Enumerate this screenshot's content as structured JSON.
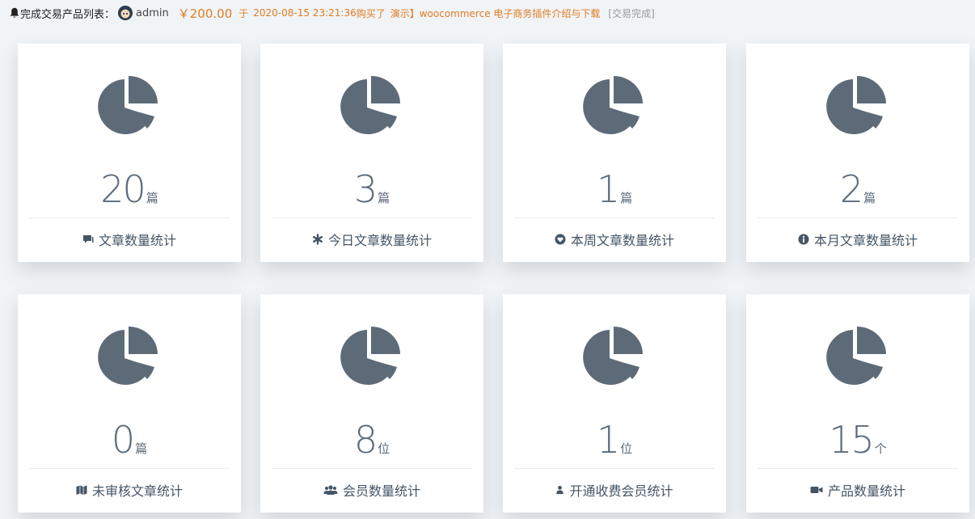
{
  "ticker": {
    "title": "完成交易产品列表：",
    "user": "admin",
    "price": "￥200.00",
    "on": "于",
    "date": "2020-08-15 23:21:36",
    "bought": "购买了",
    "product": "演示】woocommerce 电子商务插件介绍与下载",
    "status": "[交易完成]"
  },
  "colors": {
    "icon": "#5d6b79",
    "accent": "#e07b22"
  },
  "stats": [
    {
      "value": "20",
      "unit": "篇",
      "label": "文章数量统计",
      "icon": "comment-icon"
    },
    {
      "value": "3",
      "unit": "篇",
      "label": "今日文章数量统计",
      "icon": "asterisk-icon"
    },
    {
      "value": "1",
      "unit": "篇",
      "label": "本周文章数量统计",
      "icon": "heart-icon"
    },
    {
      "value": "2",
      "unit": "篇",
      "label": "本月文章数量统计",
      "icon": "info-icon"
    },
    {
      "value": "0",
      "unit": "篇",
      "label": "未审核文章统计",
      "icon": "map-icon"
    },
    {
      "value": "8",
      "unit": "位",
      "label": "会员数量统计",
      "icon": "users-icon"
    },
    {
      "value": "1",
      "unit": "位",
      "label": "开通收费会员统计",
      "icon": "user-icon"
    },
    {
      "value": "15",
      "unit": "个",
      "label": "产品数量统计",
      "icon": "video-icon"
    }
  ]
}
